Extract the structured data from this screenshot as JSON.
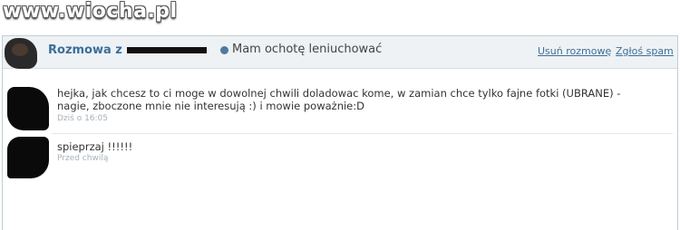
{
  "watermark": "www.wiocha.pl",
  "header": {
    "title_prefix": "Rozmowa z",
    "contact_name": "",
    "status_icon": "status-dot-icon",
    "status_text": "Mam ochotę leniuchować",
    "remove_link": "Usuń rozmowę",
    "report_link": "Zgłoś spam"
  },
  "messages": [
    {
      "text": "hejka, jak chcesz to ci moge w dowolnej chwili doladowac kome, w zamian chce tylko fajne fotki (UBRANE) - nagie, zboczone mnie nie interesują :) i mowie poważnie:D",
      "time": "Dziś o 16:05"
    },
    {
      "text": "spieprzaj !!!!!!",
      "time": "Przed chwilą"
    }
  ],
  "colors": {
    "title": "#3b6e9b",
    "link": "#3f6e99",
    "header_bg": "#eef2f4",
    "time": "#a8b1b8"
  }
}
